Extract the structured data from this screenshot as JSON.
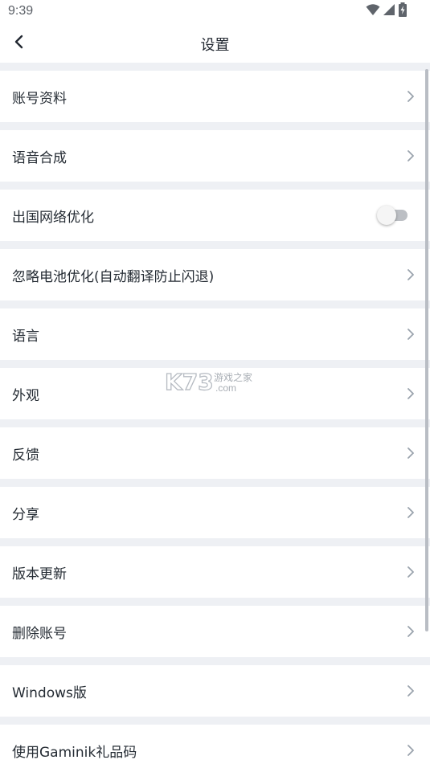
{
  "status_bar": {
    "time": "9:39",
    "icons": [
      "wifi-icon",
      "cellular-signal-icon",
      "battery-charging-icon"
    ]
  },
  "header": {
    "title": "设置",
    "back_icon": "chevron-left-icon"
  },
  "settings": {
    "items": [
      {
        "label": "账号资料",
        "control": "chevron"
      },
      {
        "label": "语音合成",
        "control": "chevron"
      },
      {
        "label": "出国网络优化",
        "control": "toggle",
        "toggle_on": false
      },
      {
        "label": "忽略电池优化(自动翻译防止闪退)",
        "control": "chevron"
      },
      {
        "label": "语言",
        "control": "chevron"
      },
      {
        "label": "外观",
        "control": "chevron"
      },
      {
        "label": "反馈",
        "control": "chevron"
      },
      {
        "label": "分享",
        "control": "chevron"
      },
      {
        "label": "版本更新",
        "control": "chevron"
      },
      {
        "label": "删除账号",
        "control": "chevron"
      },
      {
        "label": "Windows版",
        "control": "chevron"
      },
      {
        "label": "使用Gaminik礼品码",
        "control": "chevron"
      }
    ]
  },
  "watermark": {
    "logo": "K73",
    "sub": "游戏之家",
    "domain": ".com"
  },
  "colors": {
    "background": "#eef0f4",
    "row": "#ffffff",
    "text": "#242b33",
    "chevron": "#9aa3ad",
    "toggle_track_off": "#bcbfc4"
  }
}
